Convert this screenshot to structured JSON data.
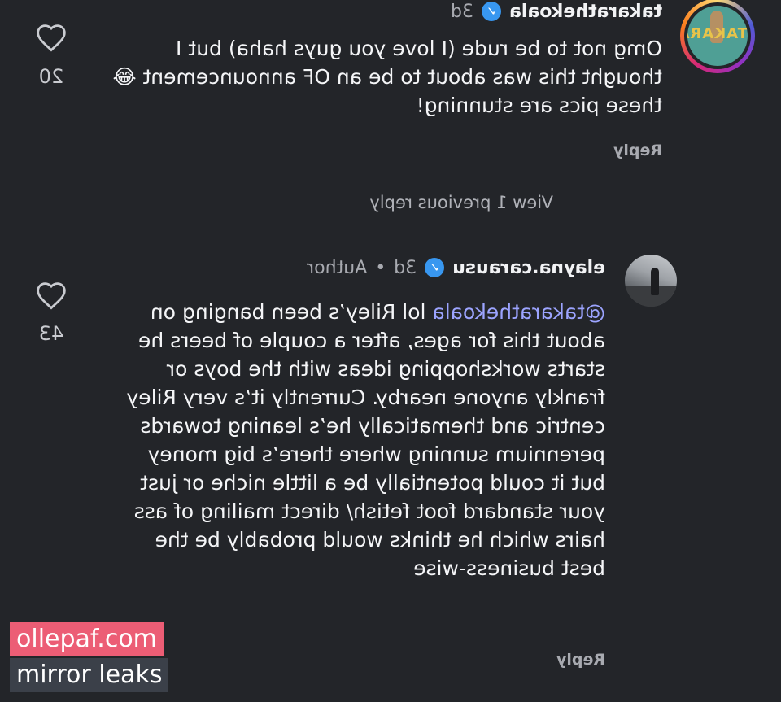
{
  "comments": [
    {
      "username": "takarathekoala",
      "time": "3d",
      "verified_icon": "verified-check-icon",
      "avatar_text": "TAKARA",
      "text": "Omg not to be rude (I love you guys haha) but I thought this was about to be an OF announcement 😂 these pics are stunning!",
      "reply_label": "Reply",
      "like_count": "20"
    },
    {
      "username": "elayna.carausu",
      "time": "3d",
      "separator": "•",
      "author_label": "Author",
      "verified_icon": "verified-check-icon",
      "mention": "@takarathekoala",
      "text": "lol Riley’s been banging on about this for ages, after a couple of beers he starts workshopping ideas with the boys or frankly anyone nearby. Currently it’s very Riley centric and thematically he’s leaning towards perennium sunning where there’s big money but it could potentially be a little niche or just your standard foot fetish/ direct mailing of ass hairs which he thinks would probably be the best business-wise",
      "reply_label": "Reply",
      "like_count": "43"
    }
  ],
  "view_replies": "View 1 previous reply",
  "watermark": {
    "site": "ollepaf.com",
    "tagline": "mirror leaks"
  },
  "colors": {
    "background": "#232529",
    "mention": "#9ca4ff",
    "verified": "#3897f0",
    "watermark_pink": "#ec5d75"
  }
}
